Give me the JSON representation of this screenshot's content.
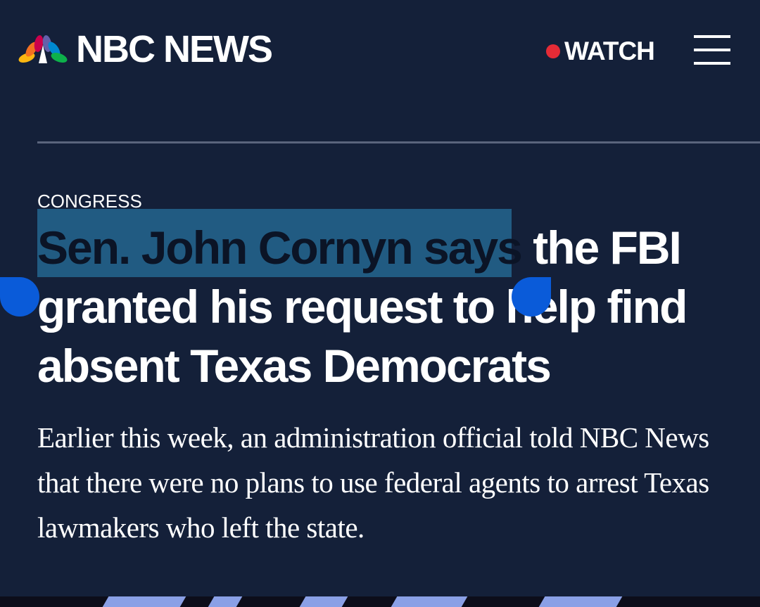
{
  "header": {
    "logo_text": "NBC NEWS",
    "watch_label": "WATCH",
    "live_color": "#e52b36",
    "menu_icon": "hamburger-menu-icon",
    "logo_icon": "nbc-peacock-icon"
  },
  "article": {
    "section": "CONGRESS",
    "headline_selected": "Sen. John Cornyn says",
    "headline_rest": " the FBI granted his request to help find absent Texas Democrats",
    "dek": "Earlier this week, an administration official told NBC News that there were no plans to use federal agents to arrest Texas lawmakers who left the state."
  },
  "colors": {
    "background": "#142039",
    "selection": "#215b82",
    "selection_handle": "#0a5bd9",
    "divider": "#5a647c"
  }
}
